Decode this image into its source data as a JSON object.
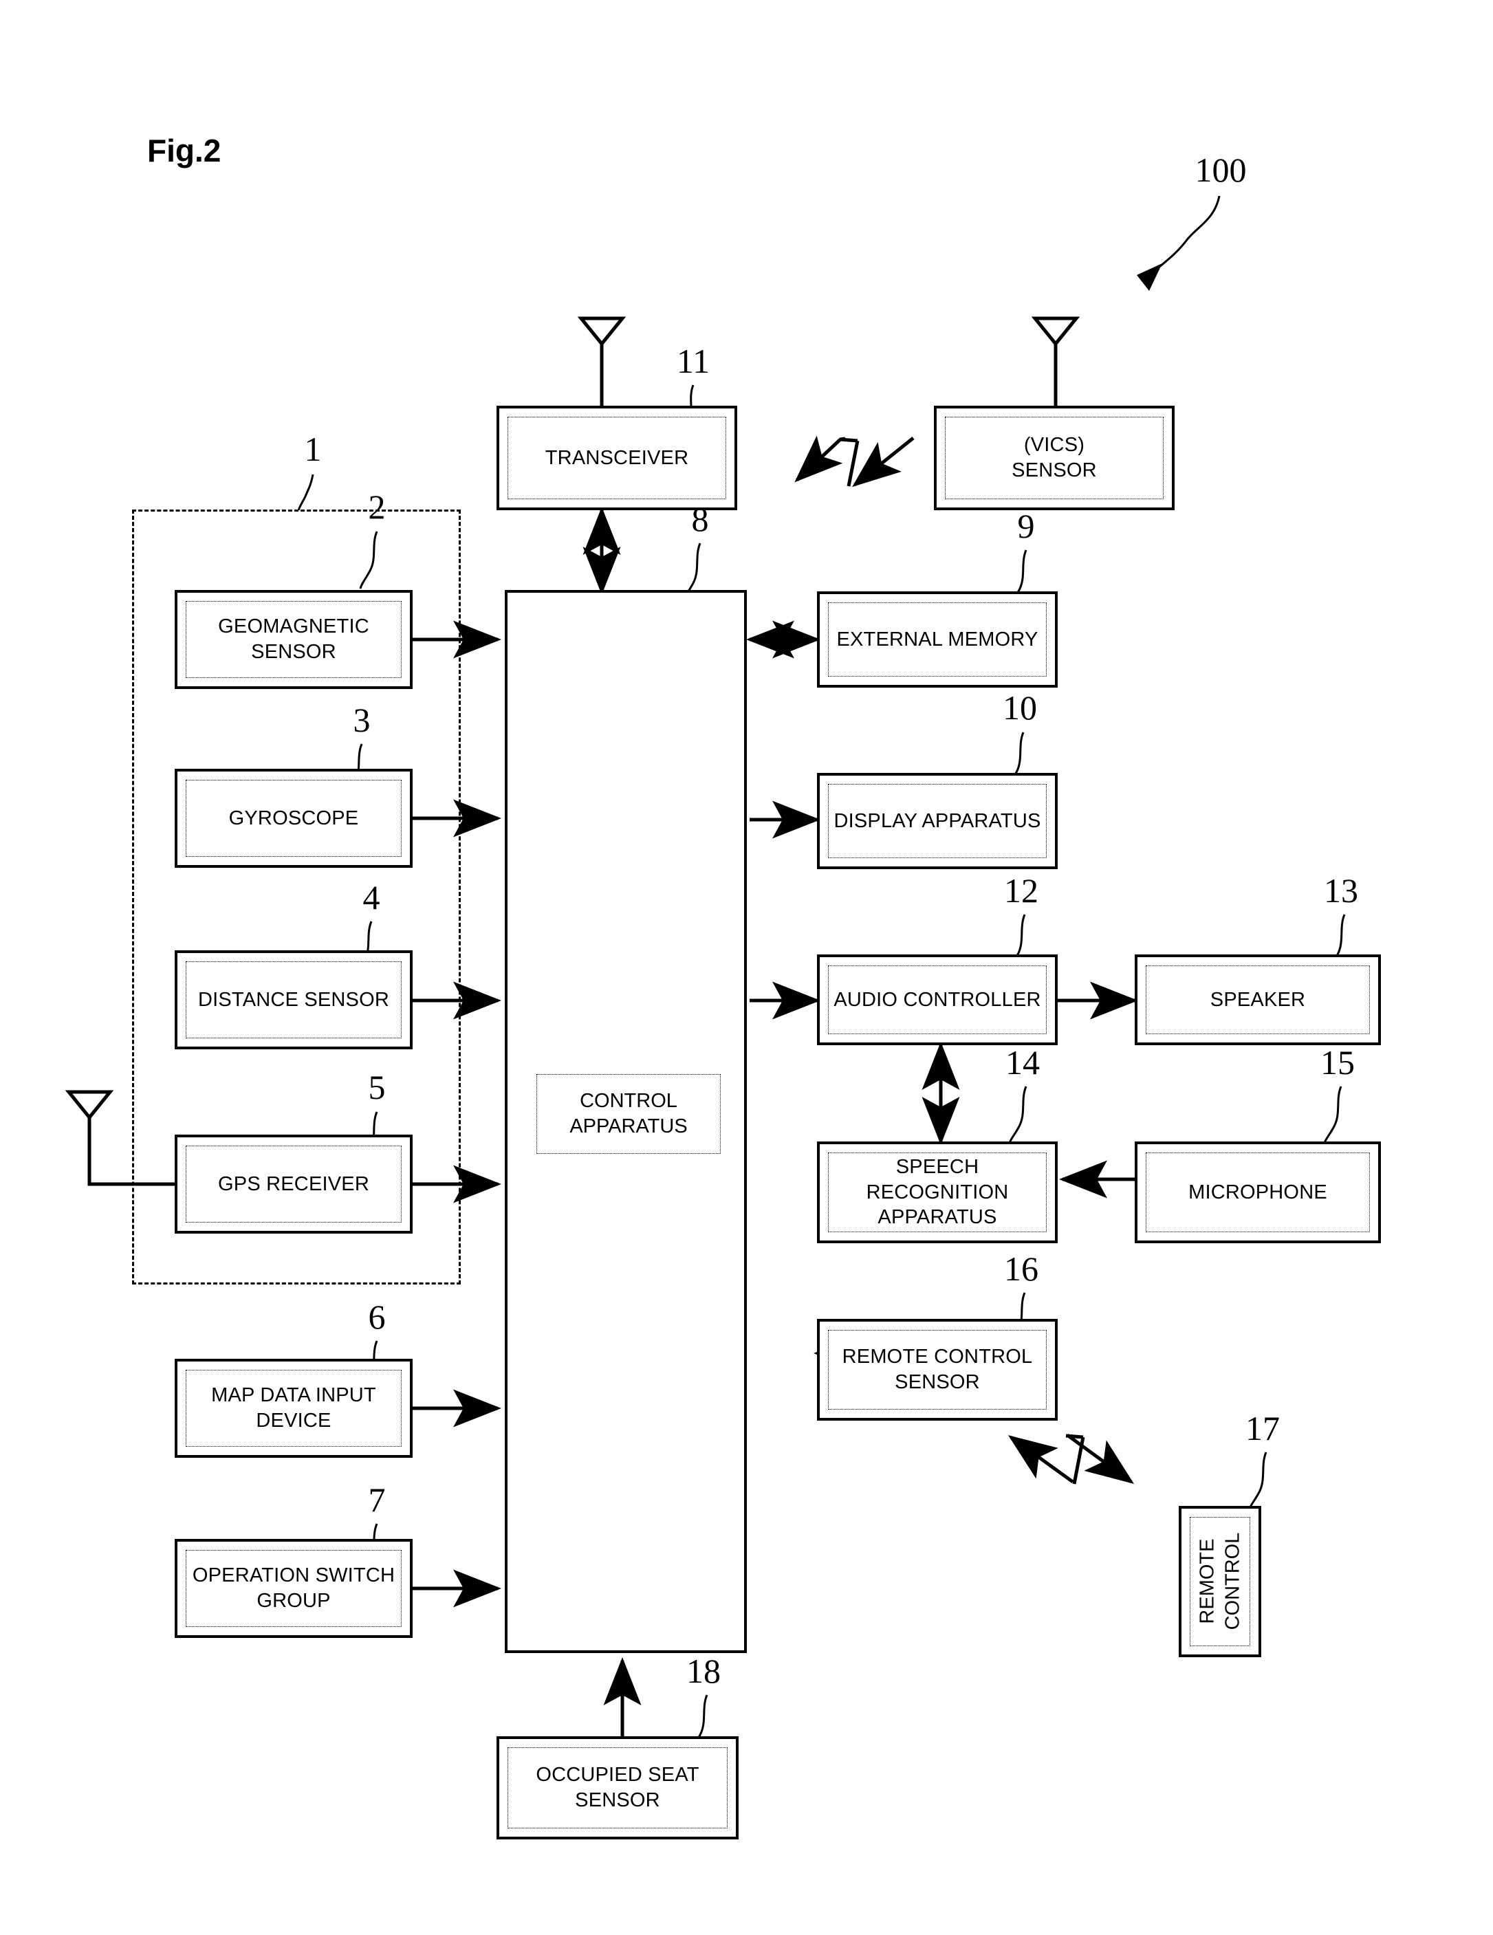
{
  "figure": {
    "label": "Fig.2",
    "system_ref": "100"
  },
  "blocks": [
    {
      "id": "transceiver",
      "ref": "11",
      "label": "TRANSCEIVER"
    },
    {
      "id": "vics_sensor",
      "ref": "",
      "label": "(VICS)\nSENSOR"
    },
    {
      "id": "geomagnetic_sensor",
      "ref": "2",
      "label": "GEOMAGNETIC\nSENSOR"
    },
    {
      "id": "gyroscope",
      "ref": "3",
      "label": "GYROSCOPE"
    },
    {
      "id": "distance_sensor",
      "ref": "4",
      "label": "DISTANCE SENSOR"
    },
    {
      "id": "gps_receiver",
      "ref": "5",
      "label": "GPS RECEIVER"
    },
    {
      "id": "map_data_input",
      "ref": "6",
      "label": "MAP DATA INPUT\nDEVICE"
    },
    {
      "id": "operation_switch",
      "ref": "7",
      "label": "OPERATION SWITCH\nGROUP"
    },
    {
      "id": "control_apparatus",
      "ref": "8",
      "label": "CONTROL\nAPPARATUS"
    },
    {
      "id": "external_memory",
      "ref": "9",
      "label": "EXTERNAL MEMORY"
    },
    {
      "id": "display_apparatus",
      "ref": "10",
      "label": "DISPLAY APPARATUS"
    },
    {
      "id": "audio_controller",
      "ref": "12",
      "label": "AUDIO CONTROLLER"
    },
    {
      "id": "speaker",
      "ref": "13",
      "label": "SPEAKER"
    },
    {
      "id": "speech_recognition",
      "ref": "14",
      "label": "SPEECH RECOGNITION\nAPPARATUS"
    },
    {
      "id": "microphone",
      "ref": "15",
      "label": "MICROPHONE"
    },
    {
      "id": "remote_control_sensor",
      "ref": "16",
      "label": "REMOTE CONTROL\nSENSOR"
    },
    {
      "id": "remote_control",
      "ref": "17",
      "label": "REMOTE\nCONTROL"
    },
    {
      "id": "occupied_seat_sensor",
      "ref": "18",
      "label": "OCCUPIED SEAT\nSENSOR"
    }
  ],
  "groups": [
    {
      "id": "sensor_group",
      "ref": "1",
      "label": ""
    }
  ],
  "refs": {
    "r1": "1",
    "r2": "2",
    "r3": "3",
    "r4": "4",
    "r5": "5",
    "r6": "6",
    "r7": "7",
    "r8": "8",
    "r9": "9",
    "r10": "10",
    "r11": "11",
    "r12": "12",
    "r13": "13",
    "r14": "14",
    "r15": "15",
    "r16": "16",
    "r17": "17",
    "r18": "18",
    "r100": "100"
  },
  "labels": {
    "transceiver": "TRANSCEIVER",
    "vics_sensor": "(VICS)\nSENSOR",
    "geomagnetic_sensor": "GEOMAGNETIC\nSENSOR",
    "gyroscope": "GYROSCOPE",
    "distance_sensor": "DISTANCE SENSOR",
    "gps_receiver": "GPS RECEIVER",
    "map_data_input": "MAP DATA INPUT\nDEVICE",
    "operation_switch": "OPERATION SWITCH\nGROUP",
    "control_apparatus": "CONTROL\nAPPARATUS",
    "external_memory": "EXTERNAL MEMORY",
    "display_apparatus": "DISPLAY APPARATUS",
    "audio_controller": "AUDIO CONTROLLER",
    "speaker": "SPEAKER",
    "speech_recognition": "SPEECH RECOGNITION\nAPPARATUS",
    "microphone": "MICROPHONE",
    "remote_control_sensor": "REMOTE CONTROL\nSENSOR",
    "remote_control": "REMOTE\nCONTROL",
    "occupied_seat_sensor": "OCCUPIED SEAT\nSENSOR"
  },
  "colors": {
    "ink": "#000000",
    "paper": "#ffffff"
  },
  "icons": {
    "antenna_transceiver": "antenna-icon",
    "antenna_vics": "antenna-icon",
    "antenna_gps": "antenna-icon",
    "wireless_link_vics": "wireless-zigzag-icon",
    "wireless_link_remote": "wireless-zigzag-icon"
  }
}
